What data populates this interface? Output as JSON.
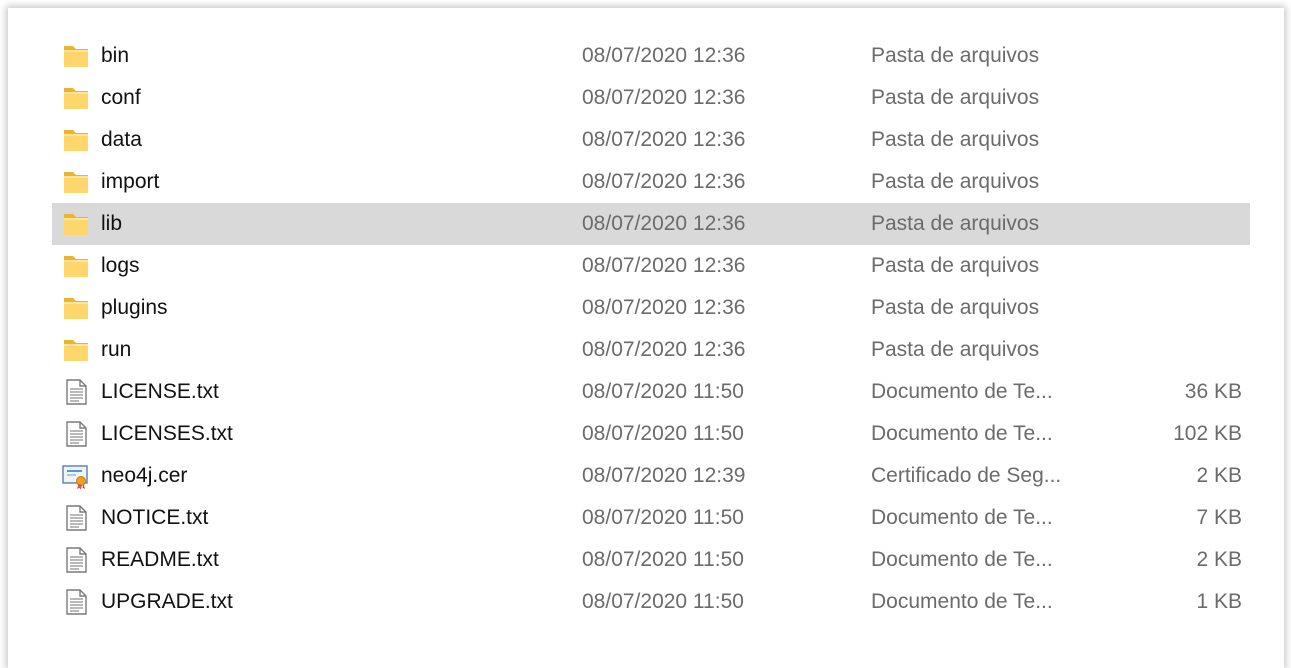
{
  "files": [
    {
      "name": "bin",
      "date": "08/07/2020 12:36",
      "type": "Pasta de arquivos",
      "size": "",
      "icon": "folder-icon",
      "selected": false
    },
    {
      "name": "conf",
      "date": "08/07/2020 12:36",
      "type": "Pasta de arquivos",
      "size": "",
      "icon": "folder-icon",
      "selected": false
    },
    {
      "name": "data",
      "date": "08/07/2020 12:36",
      "type": "Pasta de arquivos",
      "size": "",
      "icon": "folder-icon",
      "selected": false
    },
    {
      "name": "import",
      "date": "08/07/2020 12:36",
      "type": "Pasta de arquivos",
      "size": "",
      "icon": "folder-icon",
      "selected": false
    },
    {
      "name": "lib",
      "date": "08/07/2020 12:36",
      "type": "Pasta de arquivos",
      "size": "",
      "icon": "folder-icon",
      "selected": true
    },
    {
      "name": "logs",
      "date": "08/07/2020 12:36",
      "type": "Pasta de arquivos",
      "size": "",
      "icon": "folder-icon",
      "selected": false
    },
    {
      "name": "plugins",
      "date": "08/07/2020 12:36",
      "type": "Pasta de arquivos",
      "size": "",
      "icon": "folder-icon",
      "selected": false
    },
    {
      "name": "run",
      "date": "08/07/2020 12:36",
      "type": "Pasta de arquivos",
      "size": "",
      "icon": "folder-icon",
      "selected": false
    },
    {
      "name": "LICENSE.txt",
      "date": "08/07/2020 11:50",
      "type": "Documento de Te...",
      "size": "36 KB",
      "icon": "text-document-icon",
      "selected": false
    },
    {
      "name": "LICENSES.txt",
      "date": "08/07/2020 11:50",
      "type": "Documento de Te...",
      "size": "102 KB",
      "icon": "text-document-icon",
      "selected": false
    },
    {
      "name": "neo4j.cer",
      "date": "08/07/2020 12:39",
      "type": "Certificado de Seg...",
      "size": "2 KB",
      "icon": "certificate-icon",
      "selected": false
    },
    {
      "name": "NOTICE.txt",
      "date": "08/07/2020 11:50",
      "type": "Documento de Te...",
      "size": "7 KB",
      "icon": "text-document-icon",
      "selected": false
    },
    {
      "name": "README.txt",
      "date": "08/07/2020 11:50",
      "type": "Documento de Te...",
      "size": "2 KB",
      "icon": "text-document-icon",
      "selected": false
    },
    {
      "name": "UPGRADE.txt",
      "date": "08/07/2020 11:50",
      "type": "Documento de Te...",
      "size": "1 KB",
      "icon": "text-document-icon",
      "selected": false
    }
  ],
  "colors": {
    "selected_row": "#d9d9d9",
    "folder": "#ffd66b",
    "folder_dark": "#e8b530",
    "secondary_text": "#6b6b6b"
  }
}
